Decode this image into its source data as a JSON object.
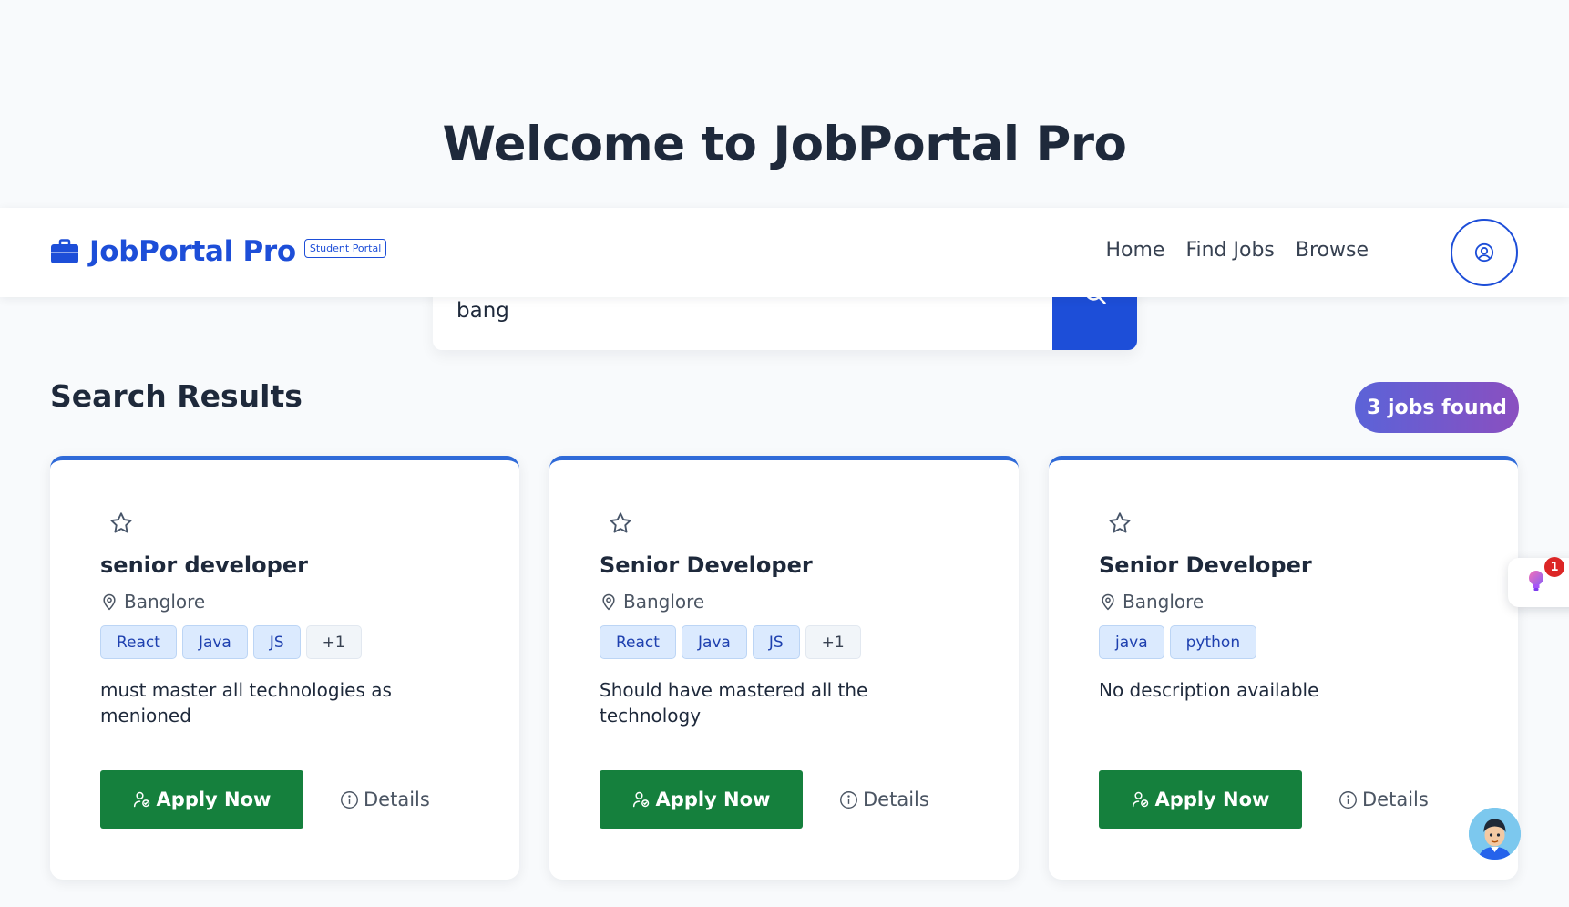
{
  "hero": {
    "title": "Welcome to JobPortal Pro"
  },
  "navbar": {
    "brand_name": "JobPortal Pro",
    "brand_badge": "Student Portal",
    "links": [
      "Home",
      "Find Jobs",
      "Browse"
    ]
  },
  "search": {
    "value": "bang"
  },
  "results": {
    "title": "Search Results",
    "count_label": "3 jobs found"
  },
  "jobs": [
    {
      "title": "senior developer",
      "location": "Banglore",
      "tags": [
        "React",
        "Java",
        "JS",
        "+1"
      ],
      "description": "must master all technologies as menioned",
      "apply_label": "Apply Now",
      "details_label": "Details"
    },
    {
      "title": "Senior Developer",
      "location": "Banglore",
      "tags": [
        "React",
        "Java",
        "JS",
        "+1"
      ],
      "description": "Should have mastered all the technology",
      "apply_label": "Apply Now",
      "details_label": "Details"
    },
    {
      "title": "Senior Developer",
      "location": "Banglore",
      "tags": [
        "java",
        "python"
      ],
      "description": "No description available",
      "apply_label": "Apply Now",
      "details_label": "Details"
    }
  ],
  "widgets": {
    "notification_count": "1"
  },
  "icons": {
    "brand": "briefcase-icon",
    "search": "search-icon",
    "profile": "user-circle-icon",
    "favorite": "star-icon",
    "location": "map-pin-icon",
    "apply": "user-check-icon",
    "details": "info-icon",
    "tips": "lightbulb-icon"
  },
  "colors": {
    "primary": "#1d4ed8",
    "apply": "#15803d",
    "badge_gradient_start": "#5b63d8",
    "badge_gradient_end": "#8a4fc0",
    "notification": "#dc2626"
  }
}
